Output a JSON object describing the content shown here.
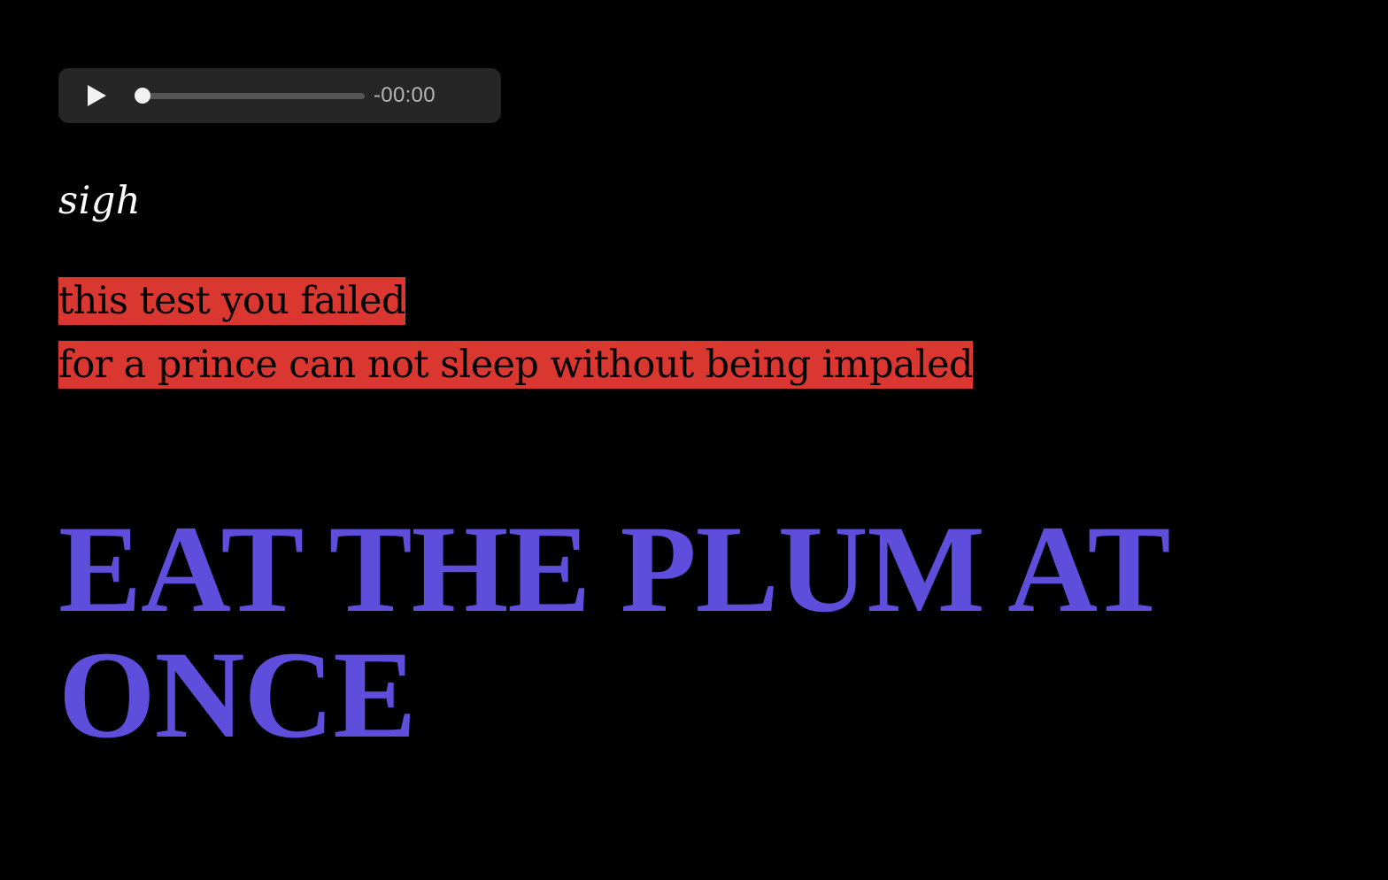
{
  "audio_player": {
    "play_icon": "play-icon",
    "progress": 0,
    "time_remaining": "-00:00"
  },
  "sigh_text": "sigh",
  "highlighted_lines": [
    "this test you failed",
    "for a prince can not sleep without being impaled"
  ],
  "heading": "EAT THE PLUM AT ONCE",
  "colors": {
    "background": "#000000",
    "player_background": "#262626",
    "highlight": "#d9372f",
    "heading": "#5f4ddc",
    "sigh_text": "#ffffff"
  }
}
